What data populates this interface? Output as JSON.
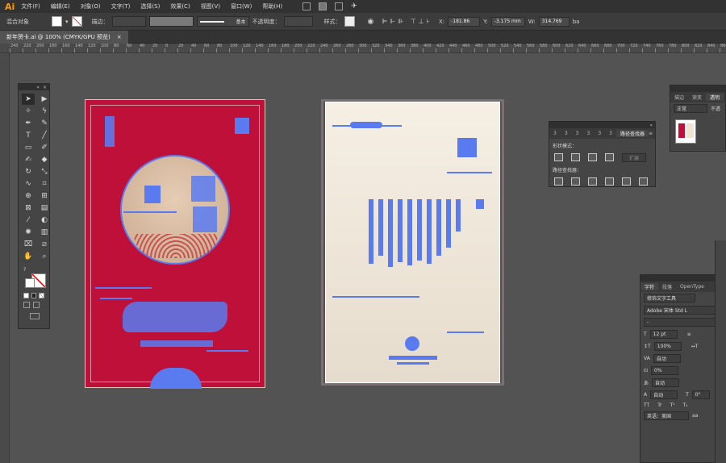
{
  "app": {
    "logo": "Ai",
    "menus": [
      "文件(F)",
      "编辑(E)",
      "对象(O)",
      "文字(T)",
      "选择(S)",
      "效果(C)",
      "视图(V)",
      "窗口(W)",
      "帮助(H)"
    ]
  },
  "control_bar": {
    "selection": "混合对象",
    "stroke_label": "描边：",
    "stroke_style": "基本",
    "opacity_label": "不透明度：",
    "style_label": "样式：",
    "x_value": "-181.86",
    "y_value": "-3.175 mm",
    "w_value": "314.769",
    "extra": "ba"
  },
  "document_tab": {
    "title": "新年贺卡.ai @ 100% (CMYK/GPU 预览)",
    "close": "×"
  },
  "ruler": {
    "labels": [
      "240",
      "220",
      "200",
      "180",
      "160",
      "140",
      "120",
      "100",
      "80",
      "60",
      "40",
      "20",
      "0",
      "20",
      "40",
      "60",
      "80",
      "100",
      "120",
      "140",
      "160",
      "180",
      "200",
      "220",
      "240",
      "260",
      "280",
      "300",
      "320",
      "340",
      "360",
      "380",
      "400",
      "420",
      "440",
      "460",
      "480",
      "500",
      "520",
      "540",
      "560",
      "580",
      "600",
      "620",
      "640",
      "660",
      "680",
      "700",
      "720",
      "740",
      "760",
      "780",
      "800",
      "820",
      "840",
      "860",
      "880"
    ]
  },
  "pathfinder": {
    "tabs": [
      "3",
      "3",
      "3",
      "3",
      "3",
      "3",
      "路径查找器"
    ],
    "shape_modes_label": "形状模式：",
    "expand_label": "扩展",
    "pathfinder_label": "路径查找器："
  },
  "transparency": {
    "tabs": [
      "描边",
      "渐变",
      "透明"
    ],
    "blend_mode": "正常",
    "opacity_label": "不透"
  },
  "character": {
    "tabs": [
      "字符",
      "段落",
      "OpenType"
    ],
    "touch_tool": "修饰文字工具",
    "font": "Adobe 宋体 Std L",
    "font_style": "-",
    "size": "12 pt",
    "leading": "",
    "h_scale": "100%",
    "v_scale": "100%",
    "kern": "自动",
    "tracking": "0%",
    "rotate": "0°",
    "auto1": "自动",
    "auto2": "自动",
    "auto3": "自动",
    "language": "英语：美国",
    "tt_glyphs": [
      "TT",
      "Tr",
      "T¹",
      "T₁"
    ]
  }
}
